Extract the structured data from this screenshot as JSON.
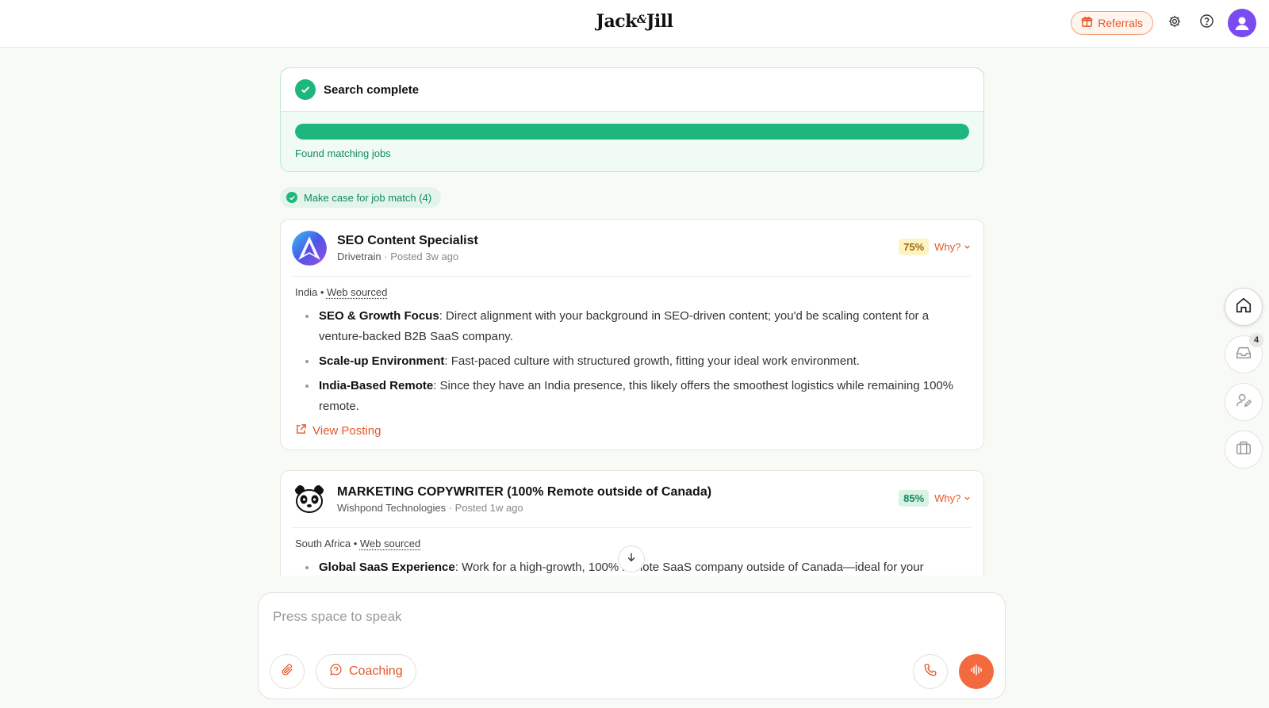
{
  "header": {
    "logo_left": "Jack",
    "logo_amp": "&",
    "logo_right": "Jill",
    "referrals_label": "Referrals",
    "icons": [
      "gift-icon",
      "gear-icon",
      "help-icon",
      "user-avatar"
    ]
  },
  "search": {
    "title": "Search complete",
    "progress": 1.0,
    "status": "Found matching jobs"
  },
  "chip": {
    "label": "Make case for job match (4)"
  },
  "jobs": [
    {
      "title": "SEO Content Specialist",
      "company": "Drivetrain",
      "posted": "· Posted 3w ago",
      "match": "75%",
      "why": "Why?",
      "location": "India",
      "source": "Web sourced",
      "bullets": [
        {
          "bold": "SEO & Growth Focus",
          "text": ": Direct alignment with your background in SEO-driven content; you'd be scaling content for a venture-backed B2B SaaS company."
        },
        {
          "bold": "Scale-up Environment",
          "text": ": Fast-paced culture with structured growth, fitting your ideal work environment."
        },
        {
          "bold": "India-Based Remote",
          "text": ": Since they have an India presence, this likely offers the smoothest logistics while remaining 100% remote."
        }
      ],
      "view_label": "View Posting"
    },
    {
      "title": "MARKETING COPYWRITER (100% Remote outside of Canada)",
      "company": "Wishpond Technologies",
      "posted": "· Posted 1w ago",
      "match": "85%",
      "why": "Why?",
      "location": "South Africa",
      "source": "Web sourced",
      "bullets": [
        {
          "bold": "Global SaaS Experience",
          "text": ": Work for a high-growth, 100% remote SaaS company outside of Canada—ideal for your"
        }
      ]
    }
  ],
  "composer": {
    "placeholder": "Press space to speak",
    "coaching_label": "Coaching"
  },
  "rail": {
    "inbox_badge": "4"
  },
  "colors": {
    "accent": "#e5572a",
    "success": "#1db67c",
    "avatar": "#7a4bf0"
  }
}
